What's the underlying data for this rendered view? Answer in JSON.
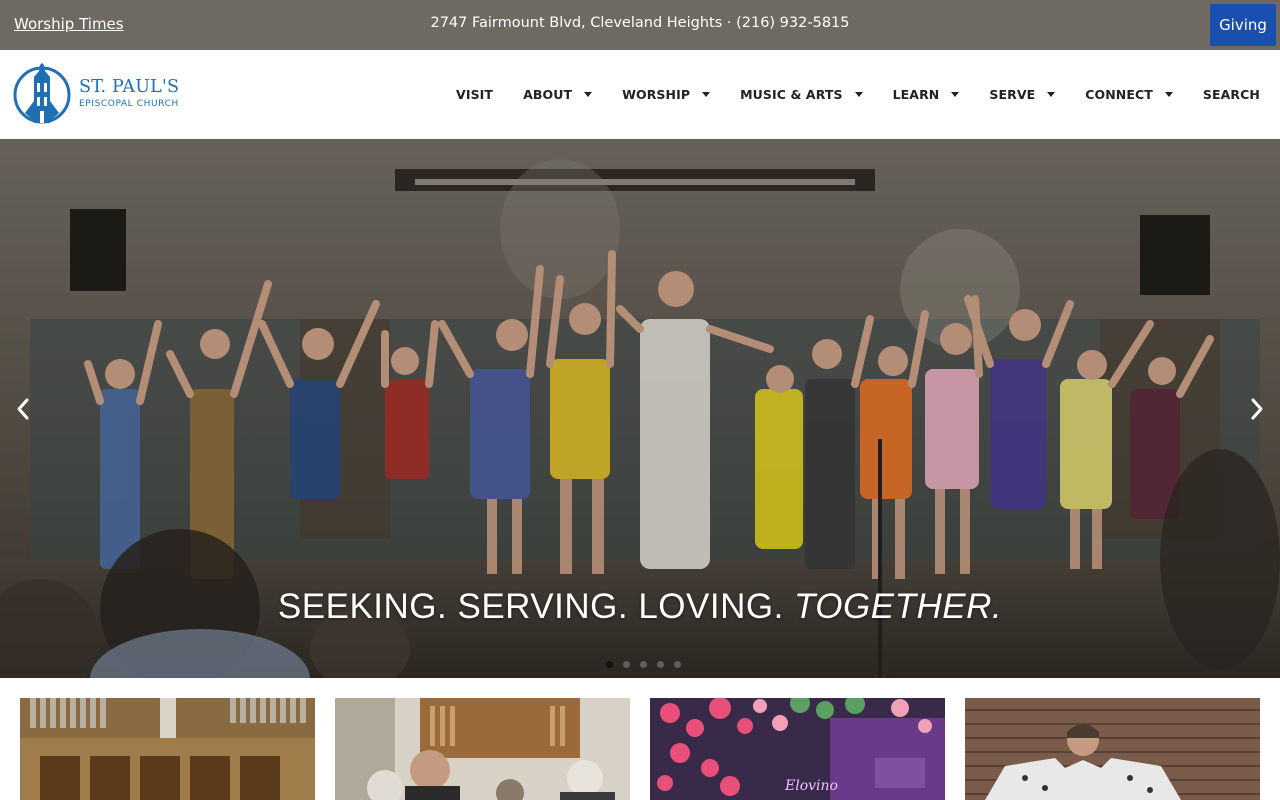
{
  "topbar": {
    "worship_times": "Worship Times",
    "address": "2747 Fairmount Blvd, Cleveland Heights · (216) 932-5815",
    "giving": "Giving",
    "bg_color": "#6e6a62",
    "giving_color": "#1a4fb0"
  },
  "logo": {
    "name": "ST. PAUL'S",
    "subtitle": "EPISCOPAL CHURCH",
    "brand_color": "#1f6fb2"
  },
  "nav": {
    "items": [
      {
        "label": "VISIT",
        "dropdown": false
      },
      {
        "label": "ABOUT",
        "dropdown": true
      },
      {
        "label": "WORSHIP",
        "dropdown": true
      },
      {
        "label": "MUSIC & ARTS",
        "dropdown": true
      },
      {
        "label": "LEARN",
        "dropdown": true
      },
      {
        "label": "SERVE",
        "dropdown": true
      },
      {
        "label": "CONNECT",
        "dropdown": true
      },
      {
        "label": "SEARCH",
        "dropdown": false
      }
    ]
  },
  "hero": {
    "tagline_main": "SEEKING. SERVING. LOVING. ",
    "tagline_emphasis": "TOGETHER.",
    "prev_icon": "chevron-left-icon",
    "next_icon": "chevron-right-icon",
    "slides_count": 5,
    "active_slide": 1
  },
  "cards": [
    {
      "name": "card-organ-altar"
    },
    {
      "name": "card-worship-service"
    },
    {
      "name": "card-arts-event"
    },
    {
      "name": "card-performance"
    }
  ]
}
